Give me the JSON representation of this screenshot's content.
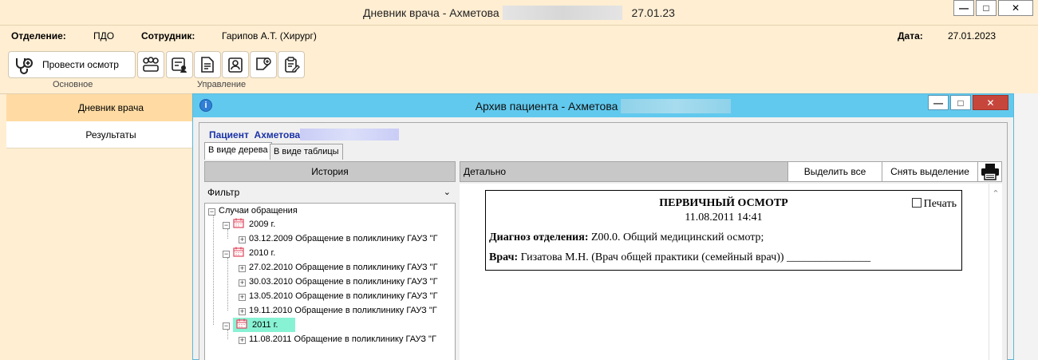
{
  "window": {
    "title_prefix": "Дневник врача - Ахметова",
    "title_date": "27.01.23",
    "minimize_glyph": "—",
    "maximize_glyph": "□",
    "close_glyph": "✕"
  },
  "info": {
    "department_label": "Отделение:",
    "department_value": "ПДО",
    "employee_label": "Сотрудник:",
    "employee_value": "Гарипов А.Т. (Хирург)",
    "date_label": "Дата:",
    "date_value": "27.01.2023"
  },
  "ribbon": {
    "exam_button_label": "Провести осмотр",
    "group_main": "Основное",
    "group_manage": "Управление"
  },
  "sidebar": {
    "items": [
      {
        "label": "Дневник врача"
      },
      {
        "label": "Результаты"
      }
    ]
  },
  "archive": {
    "title_prefix": "Архив пациента - Ахметова",
    "patient_label": "Пациент",
    "patient_name": "Ахметова",
    "tabs": [
      {
        "label": "В виде дерева"
      },
      {
        "label": "В виде таблицы"
      }
    ],
    "history_header": "История",
    "filter_label": "Фильтр",
    "tree": {
      "root": "Случаи обращения",
      "years": [
        {
          "label": "2009 г.",
          "items": [
            "03.12.2009 Обращение в поликлинику ГАУЗ \"Г"
          ]
        },
        {
          "label": "2010 г.",
          "items": [
            "27.02.2010 Обращение в поликлинику ГАУЗ \"Г",
            "30.03.2010 Обращение в поликлинику ГАУЗ \"Г",
            "13.05.2010 Обращение в поликлинику ГАУЗ \"Г",
            "19.11.2010 Обращение в поликлинику ГАУЗ \"Г"
          ]
        },
        {
          "label": "2011 г.",
          "items": [
            "11.08.2011 Обращение в поликлинику ГАУЗ \"Г"
          ]
        }
      ]
    },
    "detail": {
      "header": "Детально",
      "select_all": "Выделить все",
      "deselect": "Снять выделение",
      "card": {
        "title": "ПЕРВИЧНЫЙ ОСМОТР",
        "datetime": "11.08.2011 14:41",
        "print_label": "Печать",
        "diagnosis_label": "Диагноз отделения:",
        "diagnosis_value": "Z00.0. Общий медицинский осмотр;",
        "doctor_label": "Врач:",
        "doctor_value": "Гизатова М.Н. (Врач общей практики (семейный врач)) _______________"
      }
    }
  },
  "colors": {
    "main_bg": "#ffeed2",
    "sidebar_active": "#ffdba3",
    "archive_titlebar": "#61c9ee",
    "tree_highlight": "#88f2d4",
    "close_red": "#c7463c"
  }
}
